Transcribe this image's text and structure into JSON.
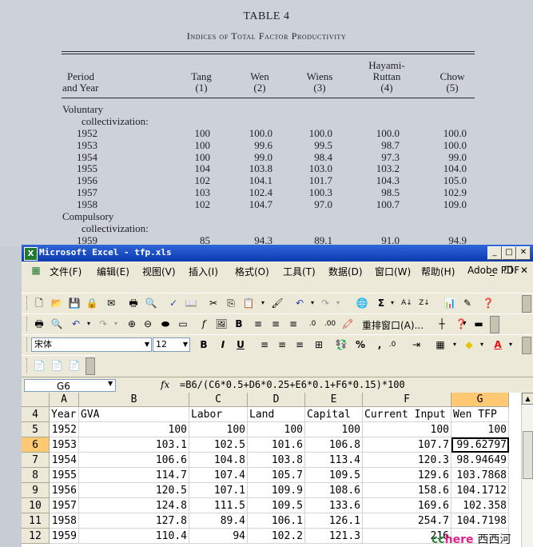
{
  "paper": {
    "title": "TABLE 4",
    "subtitle": "Indices of Total Factor Productivity",
    "headers": [
      {
        "lines": [
          "Period",
          "and Year"
        ]
      },
      {
        "lines": [
          "Tang",
          "(1)"
        ]
      },
      {
        "lines": [
          "Wen",
          "(2)"
        ]
      },
      {
        "lines": [
          "Wiens",
          "(3)"
        ]
      },
      {
        "lines": [
          "Hayami-",
          "Ruttan",
          "(4)"
        ]
      },
      {
        "lines": [
          "Chow",
          "(5)"
        ]
      }
    ],
    "section1": [
      "Voluntary",
      "collectivization:"
    ],
    "section2": [
      "Compulsory",
      "collectivization:"
    ],
    "rows1": [
      [
        "1952",
        "100",
        "100.0",
        "100.0",
        "100.0",
        "100.0"
      ],
      [
        "1953",
        "100",
        "99.6",
        "99.5",
        "98.7",
        "100.0"
      ],
      [
        "1954",
        "100",
        "99.0",
        "98.4",
        "97.3",
        "99.0"
      ],
      [
        "1955",
        "104",
        "103.8",
        "103.0",
        "103.2",
        "104.0"
      ],
      [
        "1956",
        "102",
        "104.1",
        "101.7",
        "104.3",
        "105.0"
      ],
      [
        "1957",
        "103",
        "102.4",
        "100.3",
        "98.5",
        "102.9"
      ],
      [
        "1958",
        "102",
        "104.7",
        "97.0",
        "100.7",
        "109.0"
      ]
    ],
    "rows2": [
      [
        "1959",
        "85",
        "94.3",
        "89.1",
        "91.0",
        "94.9"
      ]
    ]
  },
  "excel": {
    "title": "Microsoft Excel - tfp.xls",
    "menus": [
      "文件(F)",
      "编辑(E)",
      "视图(V)",
      "插入(I)",
      "格式(O)",
      "工具(T)",
      "数据(D)",
      "窗口(W)",
      "帮助(H)",
      "Adobe PDF"
    ],
    "toolbar3": {
      "rearrange": "重排窗口(A)..."
    },
    "font_name": "宋体",
    "font_size": "12",
    "name_box": "G6",
    "fx": "fx",
    "formula": "=B6/(C6*0.5+D6*0.25+E6*0.1+F6*0.15)*100",
    "columns": [
      "A",
      "B",
      "C",
      "D",
      "E",
      "F",
      "G"
    ],
    "rows": [
      {
        "n": "4",
        "cells": [
          "Year",
          "GVA",
          "Labor",
          "Land",
          "Capital",
          "Current Input",
          "Wen TFP"
        ]
      },
      {
        "n": "5",
        "cells": [
          "1952",
          "100",
          "100",
          "100",
          "100",
          "100",
          "100"
        ]
      },
      {
        "n": "6",
        "cells": [
          "1953",
          "103.1",
          "102.5",
          "101.6",
          "106.8",
          "107.7",
          "99.62797"
        ]
      },
      {
        "n": "7",
        "cells": [
          "1954",
          "106.6",
          "104.8",
          "103.8",
          "113.4",
          "120.3",
          "98.94649"
        ]
      },
      {
        "n": "8",
        "cells": [
          "1955",
          "114.7",
          "107.4",
          "105.7",
          "109.5",
          "129.6",
          "103.7868"
        ]
      },
      {
        "n": "9",
        "cells": [
          "1956",
          "120.5",
          "107.1",
          "109.9",
          "108.6",
          "158.6",
          "104.1712"
        ]
      },
      {
        "n": "10",
        "cells": [
          "1957",
          "124.8",
          "111.5",
          "109.5",
          "133.6",
          "169.6",
          "102.358"
        ]
      },
      {
        "n": "11",
        "cells": [
          "1958",
          "127.8",
          "89.4",
          "106.1",
          "126.1",
          "254.7",
          "104.7198"
        ]
      },
      {
        "n": "12",
        "cells": [
          "1959",
          "110.4",
          "94",
          "102.2",
          "121.3",
          "216",
          ""
        ]
      }
    ],
    "selected_cell": "G6"
  },
  "watermark": {
    "a": "cc",
    "b": "here",
    "c": "西西河"
  }
}
